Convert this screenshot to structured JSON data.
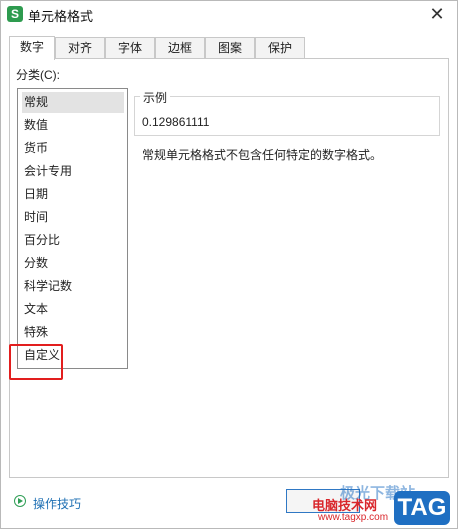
{
  "window": {
    "title": "单元格格式",
    "app_icon_letter": "S",
    "close_glyph": "✕"
  },
  "tabs": [
    "数字",
    "对齐",
    "字体",
    "边框",
    "图案",
    "保护"
  ],
  "active_tab": "数字",
  "category_label": "分类(C):",
  "categories": [
    "常规",
    "数值",
    "货币",
    "会计专用",
    "日期",
    "时间",
    "百分比",
    "分数",
    "科学记数",
    "文本",
    "特殊",
    "自定义"
  ],
  "selected_category": "常规",
  "sample": {
    "label": "示例",
    "value": "0.129861111"
  },
  "description": "常规单元格格式不包含任何特定的数字格式。",
  "footer": {
    "tips_link": "操作技巧"
  },
  "watermark": {
    "brand": "极光下载站",
    "site_name": "电脑技术网",
    "url": "www.tagxp.com",
    "badge": "TAG"
  },
  "colors": {
    "highlight": "#e21e1e",
    "selection": "#e3e3e3",
    "link": "#1d6fb3",
    "app_icon": "#2e9b4f"
  }
}
